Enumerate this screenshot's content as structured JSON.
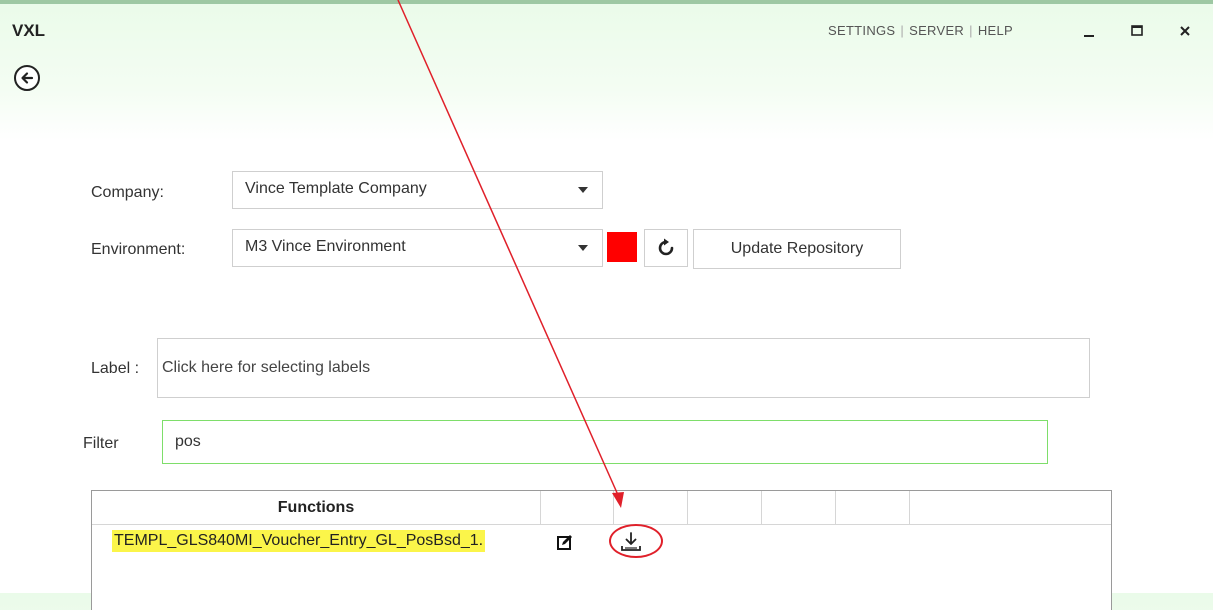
{
  "app": {
    "title": "VXL"
  },
  "topnav": {
    "settings": "SETTINGS",
    "server": "SERVER",
    "help": "HELP",
    "separator": "|"
  },
  "form": {
    "company_label": "Company:",
    "company_value": "Vince Template Company",
    "environment_label": "Environment:",
    "environment_value": "M3 Vince Environment",
    "environment_status_color": "#ff0000",
    "update_button": "Update Repository",
    "label_prefix": "Label :",
    "label_placeholder": "Click here for selecting labels",
    "filter_label": "Filter",
    "filter_value": "pos"
  },
  "table": {
    "header": "Functions",
    "rows": [
      {
        "name": "TEMPL_GLS840MI_Voucher_Entry_GL_PosBsd_1."
      }
    ]
  },
  "icons": {
    "back": "arrow-left-icon",
    "minimize": "minimize-icon",
    "maximize": "maximize-icon",
    "close": "close-icon",
    "refresh": "refresh-icon",
    "edit": "edit-icon",
    "download": "download-icon"
  },
  "colors": {
    "highlight": "#fbf54a",
    "annotation": "#e0202a",
    "filter_border": "#7ede6a"
  }
}
